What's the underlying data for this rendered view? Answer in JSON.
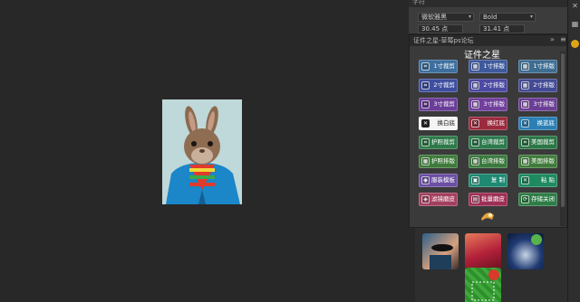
{
  "character_panel": {
    "tab_label": "字符",
    "font_family": "微软雅黑",
    "font_style": "Bold",
    "font_size": "30.45 点",
    "leading": "31.41 点"
  },
  "plugin": {
    "tab_label": "证件之星-草莓ps论坛",
    "collapse_icon": "»",
    "menu_icon": "≡",
    "title": "证件之星",
    "buttons": [
      {
        "label": "1寸裁剪",
        "color": "#3d6f9e",
        "icon": "crop-icon"
      },
      {
        "label": "1寸排版",
        "color": "#3e5a9c",
        "icon": "grid-icon"
      },
      {
        "label": "1寸排版",
        "color": "#3f6d92",
        "icon": "grid-icon"
      },
      {
        "label": "2寸裁剪",
        "color": "#3e4fa0",
        "icon": "crop-icon"
      },
      {
        "label": "2寸排版",
        "color": "#4c4aa3",
        "icon": "grid-icon"
      },
      {
        "label": "2寸排版",
        "color": "#434b95",
        "icon": "grid-icon"
      },
      {
        "label": "3寸裁剪",
        "color": "#6a3d98",
        "icon": "crop-icon"
      },
      {
        "label": "3寸排版",
        "color": "#713f9c",
        "icon": "grid-icon"
      },
      {
        "label": "3寸排版",
        "color": "#6b3f95",
        "icon": "grid-icon"
      },
      {
        "label": "换白底",
        "color": "#f4f4f4",
        "icon": "swap-icon"
      },
      {
        "label": "换红底",
        "color": "#9a2b3d",
        "icon": "swap-icon"
      },
      {
        "label": "换蓝底",
        "color": "#2b7fb3",
        "icon": "swap-icon"
      },
      {
        "label": "护照裁剪",
        "color": "#2f7a4a",
        "icon": "crop-icon"
      },
      {
        "label": "台湾裁剪",
        "color": "#2e7a4e",
        "icon": "crop-icon"
      },
      {
        "label": "美国裁剪",
        "color": "#2d7647",
        "icon": "crop-icon"
      },
      {
        "label": "护照排版",
        "color": "#3e7a3a",
        "icon": "grid-icon"
      },
      {
        "label": "台湾排版",
        "color": "#3c793f",
        "icon": "grid-icon"
      },
      {
        "label": "美国排版",
        "color": "#407b3b",
        "icon": "grid-icon"
      },
      {
        "label": "服装模板",
        "color": "#6b4fa3",
        "icon": "shirt-icon"
      },
      {
        "label": "复  制",
        "color": "#1f8a72",
        "icon": "copy-icon"
      },
      {
        "label": "粘  贴",
        "color": "#1f8a60",
        "icon": "paste-icon"
      },
      {
        "label": "滤镜磨皮",
        "color": "#a3405f",
        "icon": "filter-icon"
      },
      {
        "label": "批量磨皮",
        "color": "#9c2f55",
        "icon": "batch-icon"
      },
      {
        "label": "存储关闭",
        "color": "#2e7d46",
        "icon": "save-icon"
      }
    ]
  }
}
